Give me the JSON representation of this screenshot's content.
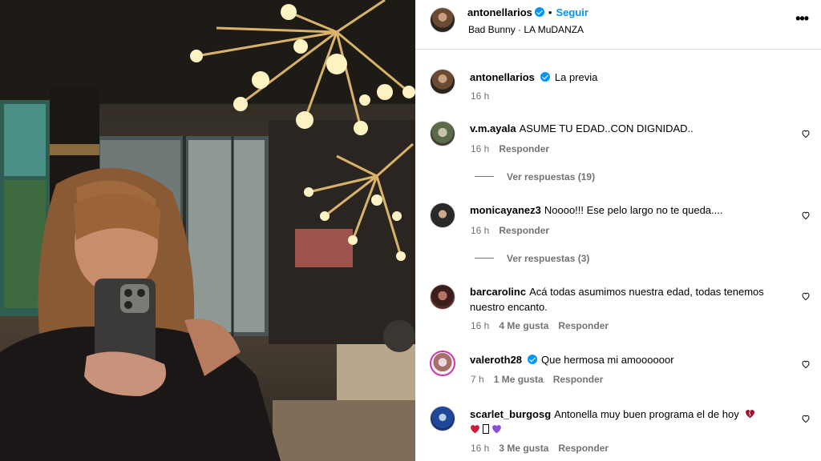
{
  "header": {
    "username": "antonellarios",
    "separator": "•",
    "follow_label": "Seguir",
    "audio": "Bad Bunny · LA MuDANZA",
    "more_label": "•••"
  },
  "caption": {
    "username": "antonellarios",
    "text": "La previa",
    "time": "16 h"
  },
  "comments": [
    {
      "username": "v.m.ayala",
      "text": "ASUME TU EDAD..CON DIGNIDAD..",
      "time": "16 h",
      "likes": "",
      "reply": "Responder",
      "view_replies": "Ver respuestas (19)"
    },
    {
      "username": "monicayanez3",
      "text": "Noooo!!! Ese pelo largo no te queda....",
      "time": "16 h",
      "likes": "",
      "reply": "Responder",
      "view_replies": "Ver respuestas (3)"
    },
    {
      "username": "barcarolinc",
      "text": "Acá todas asumimos nuestra edad, todas tenemos nuestro encanto.",
      "time": "16 h",
      "likes": "4 Me gusta",
      "reply": "Responder"
    },
    {
      "username": "valeroth28",
      "text": "Que hermosa mi amoooooor",
      "time": "7 h",
      "likes": "1 Me gusta",
      "reply": "Responder"
    },
    {
      "username": "scarlet_burgosg",
      "text": "Antonella muy buen programa el de hoy",
      "time": "16 h",
      "likes": "3 Me gusta",
      "reply": "Responder"
    }
  ],
  "icons": {
    "verified": "verified-badge-icon",
    "like": "heart-outline-icon",
    "more": "more-options-icon"
  },
  "colors": {
    "accent": "#0095f6",
    "muted": "#737373",
    "divider": "#dbdbdb"
  }
}
